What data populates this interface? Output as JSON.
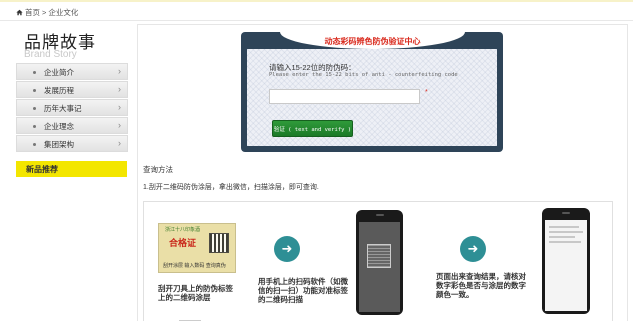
{
  "breadcrumb": {
    "home": "首页",
    "separator": ">",
    "current": "企业文化"
  },
  "sidebar": {
    "title": "品牌故事",
    "subtitle": "Brand Story",
    "items": [
      {
        "label": "企业简介"
      },
      {
        "label": "发展历程"
      },
      {
        "label": "历年大事记"
      },
      {
        "label": "企业理念"
      },
      {
        "label": "集团架构"
      }
    ],
    "new_products": "新品推荐"
  },
  "verify": {
    "header": "动态彩码辨色防伪验证中心",
    "prompt_cn": "请输入15-22位的防伪码：",
    "prompt_en": "Please enter the 15-22 bits  of anti - counterfeiting code",
    "input_value": "",
    "required_mark": "*",
    "button_label": "验证 ( text and verify )"
  },
  "query": {
    "title": "查询方法",
    "step1": "1.刮开二维码防伪涂层，拿出微信，扫描涂层，即可查询."
  },
  "steps": {
    "card_title": "浙江十八印象酒",
    "card_seal": "合格证",
    "card_footer": "刮开涂层  输入数码  查询真伪",
    "step_a": "刮开刀具上的防伪标签上的二维码涂层",
    "step_b": "用手机上的扫码软件（如微信的扫一扫）功能对准标签的二维码扫描",
    "step_c": "页面出来查询结果，请核对数字彩色是否与涂层的数字颜色一致。",
    "arrow": "➜"
  },
  "colors": {
    "accent_red": "#d9281b",
    "verify_bg": "#2e4458",
    "button_green": "#1c7a28",
    "highlight_yellow": "#f3e600",
    "arrow_teal": "#2e8f95"
  }
}
